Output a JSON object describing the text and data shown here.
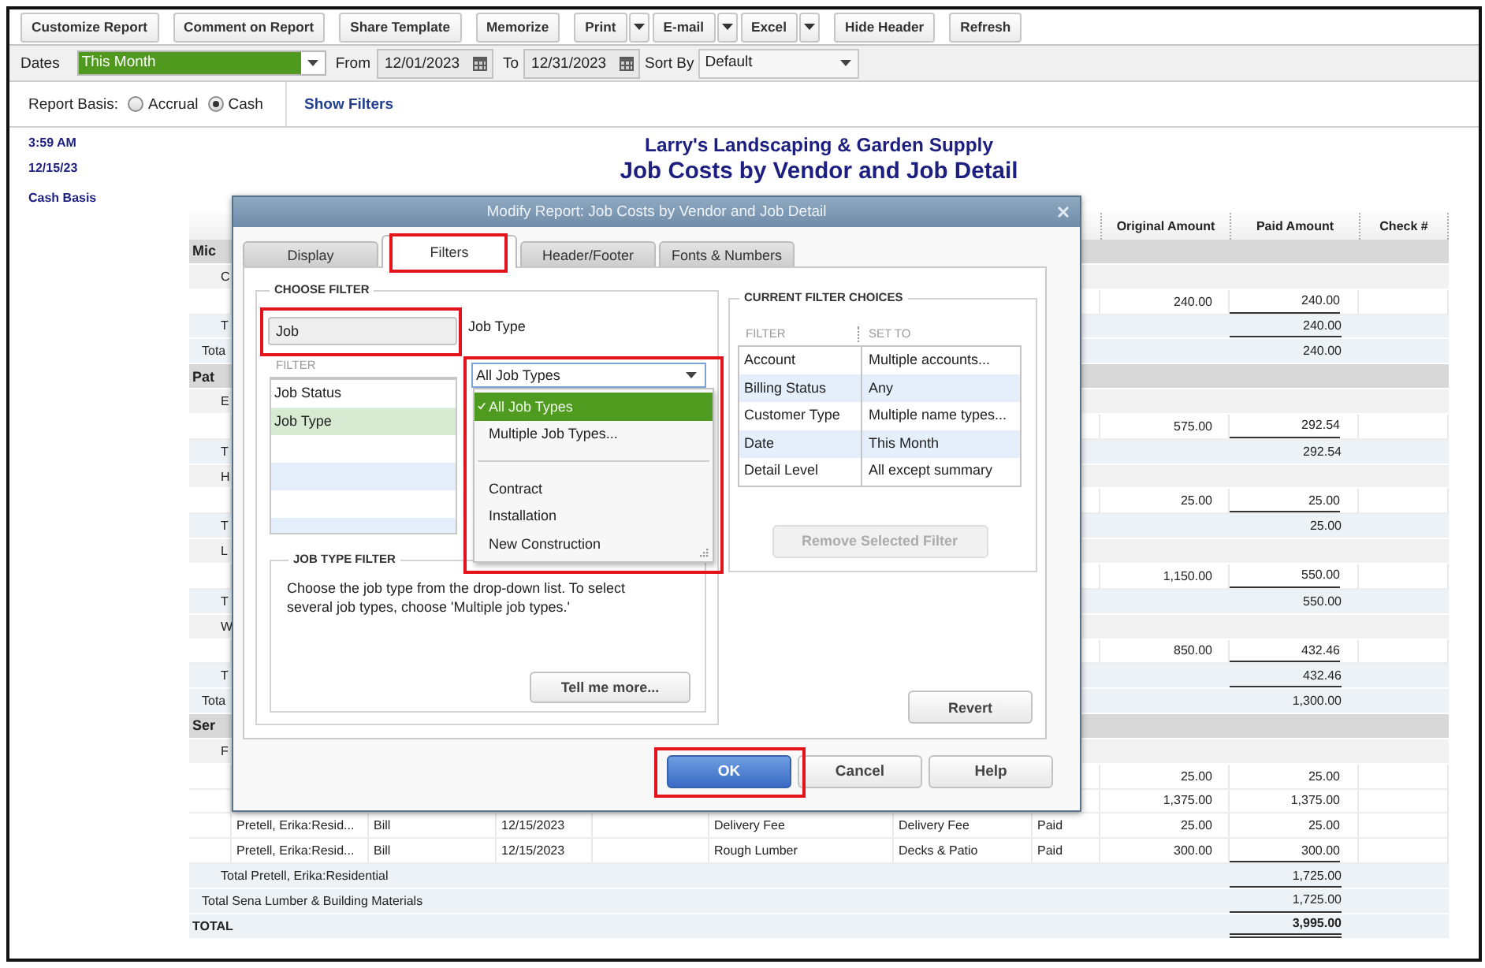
{
  "toolbar": {
    "buttons": [
      {
        "label": "Customize Report",
        "kind": "button"
      },
      {
        "label": "Comment on Report",
        "kind": "button"
      },
      {
        "label": "Share Template",
        "kind": "button"
      },
      {
        "label": "Memorize",
        "kind": "button"
      },
      {
        "label": "Print",
        "kind": "split"
      },
      {
        "label": "E-mail",
        "kind": "split"
      },
      {
        "label": "Excel",
        "kind": "split"
      },
      {
        "label": "Hide Header",
        "kind": "button"
      },
      {
        "label": "Refresh",
        "kind": "button"
      }
    ]
  },
  "date_bar": {
    "dates": {
      "label": "Dates",
      "value": "This Month"
    },
    "from": {
      "label": "From",
      "value": "12/01/2023"
    },
    "to": {
      "label": "To",
      "value": "12/31/2023"
    },
    "sort_by": {
      "label": "Sort By",
      "value": "Default"
    }
  },
  "basis_bar": {
    "label": "Report Basis:",
    "options": [
      {
        "label": "Accrual",
        "selected": false
      },
      {
        "label": "Cash",
        "selected": true
      }
    ],
    "filters_link": "Show Filters"
  },
  "report": {
    "time": "3:59 AM",
    "date": "12/15/23",
    "basis": "Cash Basis",
    "company": "Larry's Landscaping & Garden Supply",
    "title": "Job Costs by Vendor and Job Detail",
    "columns": [
      "Original Amount",
      "Paid Amount",
      "Check #"
    ],
    "rows": [
      {
        "kind": "vendor",
        "label": "Mic",
        "underline": false
      },
      {
        "kind": "customer",
        "label": "C",
        "underline": false
      },
      {
        "kind": "detail",
        "original_amount": "240.00",
        "paid_amount": "240.00",
        "underline": true
      },
      {
        "kind": "customer_total",
        "label": "T",
        "paid_amount": "240.00",
        "underline": true
      },
      {
        "kind": "vendor_total",
        "label": "Tota",
        "paid_amount": "240.00",
        "underline": false
      },
      {
        "kind": "vendor",
        "label": "Pat",
        "underline": false
      },
      {
        "kind": "customer",
        "label": "E",
        "underline": false
      },
      {
        "kind": "detail",
        "original_amount": "575.00",
        "paid_amount": "292.54",
        "underline": true
      },
      {
        "kind": "customer_total",
        "label": "T",
        "paid_amount": "292.54",
        "underline": false
      },
      {
        "kind": "customer",
        "label": "H",
        "underline": false
      },
      {
        "kind": "detail",
        "original_amount": "25.00",
        "paid_amount": "25.00",
        "underline": true
      },
      {
        "kind": "customer_total",
        "label": "T",
        "paid_amount": "25.00",
        "underline": false
      },
      {
        "kind": "customer",
        "label": "L",
        "underline": false
      },
      {
        "kind": "detail",
        "original_amount": "1,150.00",
        "paid_amount": "550.00",
        "underline": true
      },
      {
        "kind": "customer_total",
        "label": "T",
        "paid_amount": "550.00",
        "underline": false
      },
      {
        "kind": "customer",
        "label": "W",
        "underline": false
      },
      {
        "kind": "detail",
        "original_amount": "850.00",
        "paid_amount": "432.46",
        "underline": true
      },
      {
        "kind": "customer_total",
        "label": "T",
        "paid_amount": "432.46",
        "underline": true
      },
      {
        "kind": "vendor_total",
        "label": "Tota",
        "paid_amount": "1,300.00",
        "underline": false
      },
      {
        "kind": "vendor",
        "label": "Ser",
        "underline": false
      },
      {
        "kind": "customer",
        "label": "F",
        "underline": false
      },
      {
        "kind": "detail",
        "original_amount": "25.00",
        "paid_amount": "25.00",
        "underline": false
      },
      {
        "kind": "detail",
        "original_amount": "1,375.00",
        "paid_amount": "1,375.00",
        "underline": false
      },
      {
        "kind": "detail",
        "column_1": "Pretell, Erika:Resid...",
        "column_2": "Bill",
        "column_3": "12/15/2023",
        "column_5": "Delivery Fee",
        "column_6": "Delivery Fee",
        "column_7": "Paid",
        "original_amount": "25.00",
        "paid_amount": "25.00",
        "underline": false
      },
      {
        "kind": "detail",
        "column_1": "Pretell, Erika:Resid...",
        "column_2": "Bill",
        "column_3": "12/15/2023",
        "column_5": "Rough Lumber",
        "column_6": "Decks & Patio",
        "column_7": "Paid",
        "original_amount": "300.00",
        "paid_amount": "300.00",
        "underline": true
      },
      {
        "kind": "customer_total",
        "label": "Total Pretell, Erika:Residential",
        "paid_amount": "1,725.00",
        "underline": true
      },
      {
        "kind": "vendor_total",
        "label": "Total Sena Lumber & Building Materials",
        "paid_amount": "1,725.00",
        "underline": true
      },
      {
        "kind": "grand_total",
        "label": "TOTAL",
        "paid_amount": "3,995.00",
        "underline": true
      }
    ]
  },
  "dialog": {
    "title": "Modify Report: Job Costs by Vendor and Job Detail",
    "tabs": [
      {
        "label": "Display",
        "selected": false,
        "highlighted": false
      },
      {
        "label": "Filters",
        "selected": true,
        "highlighted": true
      },
      {
        "label": "Header/Footer",
        "selected": false,
        "highlighted": false
      },
      {
        "label": "Fonts & Numbers",
        "selected": false,
        "highlighted": false
      }
    ],
    "choose_filter": {
      "heading": "CHOOSE FILTER",
      "search": {
        "value": "Job",
        "highlighted": true
      },
      "list_heading": "FILTER",
      "filters": [
        {
          "label": "Job Status",
          "selected": false
        },
        {
          "label": "Job Type",
          "selected": true
        }
      ],
      "filter_name": "Job Type",
      "dropdown": {
        "value": "All Job Types",
        "expanded": true,
        "highlighted": true,
        "option_groups": [
          {
            "options": [
              {
                "label": "All Job Types",
                "selected": true
              },
              {
                "label": "Multiple Job Types...",
                "selected": false
              }
            ]
          },
          {
            "options": [
              {
                "label": "Contract",
                "selected": false
              },
              {
                "label": "Installation",
                "selected": false
              },
              {
                "label": "New Construction",
                "selected": false
              }
            ]
          }
        ]
      },
      "help": {
        "heading": "JOB TYPE FILTER",
        "text": "Choose the job type from the drop-down list. To select several job types, choose 'Multiple job types.'",
        "button": "Tell me more..."
      }
    },
    "current_filters": {
      "heading": "CURRENT FILTER CHOICES",
      "columns": [
        "FILTER",
        "SET TO"
      ],
      "rows": [
        {
          "filter": "Account",
          "set_to": "Multiple accounts..."
        },
        {
          "filter": "Billing Status",
          "set_to": "Any"
        },
        {
          "filter": "Customer Type",
          "set_to": "Multiple name types..."
        },
        {
          "filter": "Date",
          "set_to": "This Month"
        },
        {
          "filter": "Detail Level",
          "set_to": "All except summary"
        }
      ],
      "remove_button": {
        "label": "Remove Selected Filter",
        "disabled": true
      }
    },
    "revert_button": "Revert",
    "buttons": [
      {
        "label": "OK",
        "kind": "primary",
        "highlighted": true
      },
      {
        "label": "Cancel",
        "kind": "default",
        "highlighted": false
      },
      {
        "label": "Help",
        "kind": "default",
        "highlighted": false
      }
    ]
  }
}
